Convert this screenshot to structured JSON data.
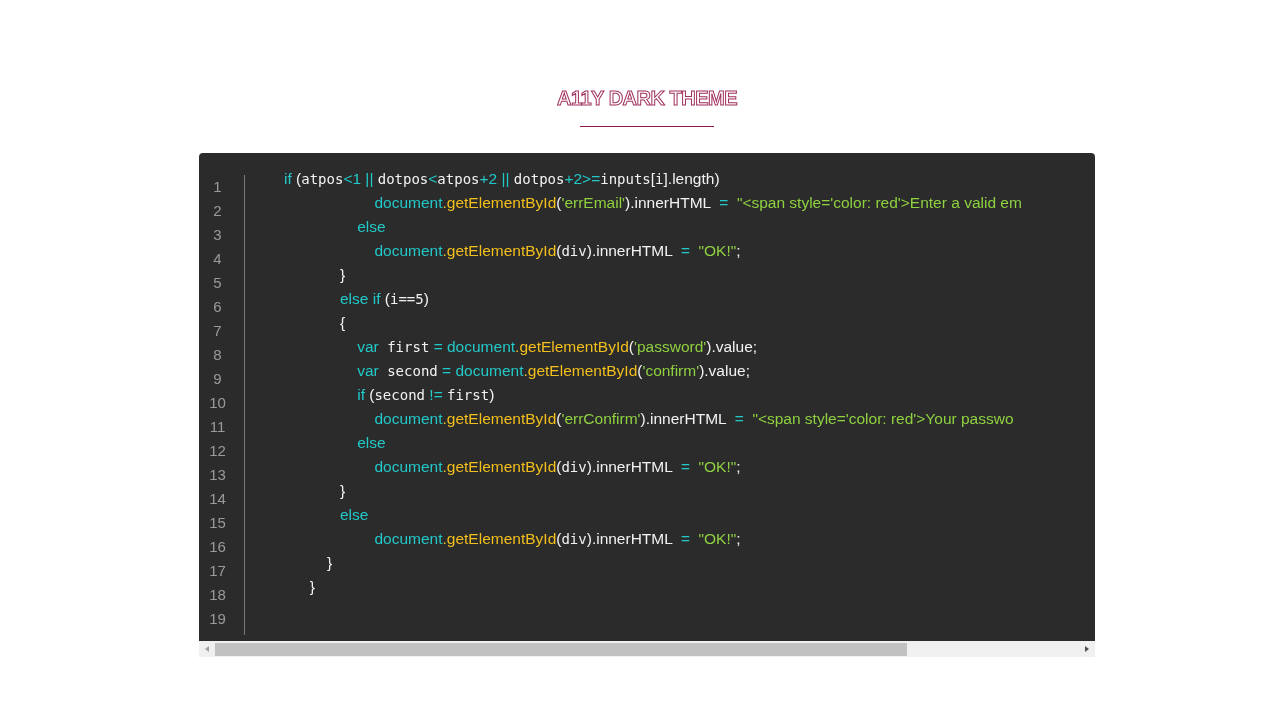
{
  "title": "A11Y DARK THEME",
  "code_block": {
    "lines": [
      {
        "number": "1",
        "tokens": [
          {
            "kind": "kw",
            "text": "if"
          },
          {
            "kind": "punct",
            "text": " ("
          },
          {
            "kind": "var",
            "text": "atpos"
          },
          {
            "kind": "op",
            "text": "<1 || "
          },
          {
            "kind": "var",
            "text": "dotpos"
          },
          {
            "kind": "op",
            "text": "<"
          },
          {
            "kind": "var",
            "text": "atpos"
          },
          {
            "kind": "op",
            "text": "+2 || "
          },
          {
            "kind": "var",
            "text": "dotpos"
          },
          {
            "kind": "op",
            "text": "+2>="
          },
          {
            "kind": "var",
            "text": "inputs"
          },
          {
            "kind": "punct",
            "text": "["
          },
          {
            "kind": "var",
            "text": "i"
          },
          {
            "kind": "punct",
            "text": "].length)"
          }
        ]
      },
      {
        "number": "2",
        "tokens": [
          {
            "kind": "obj",
            "text": "                     document"
          },
          {
            "kind": "method",
            "text": ".getElementById"
          },
          {
            "kind": "punct",
            "text": "("
          },
          {
            "kind": "str",
            "text": "'errEmail'"
          },
          {
            "kind": "punct",
            "text": ").innerHTML "
          },
          {
            "kind": "op",
            "text": " = "
          },
          {
            "kind": "str",
            "text": " \"<span style='color: red'>Enter a valid em"
          }
        ]
      },
      {
        "number": "3",
        "tokens": [
          {
            "kind": "kw",
            "text": "                 else"
          }
        ]
      },
      {
        "number": "4",
        "tokens": [
          {
            "kind": "obj",
            "text": "                     document"
          },
          {
            "kind": "method",
            "text": ".getElementById"
          },
          {
            "kind": "punct",
            "text": "("
          },
          {
            "kind": "var",
            "text": "div"
          },
          {
            "kind": "punct",
            "text": ").innerHTML "
          },
          {
            "kind": "op",
            "text": " = "
          },
          {
            "kind": "str",
            "text": " \"OK!\""
          },
          {
            "kind": "punct",
            "text": ";"
          }
        ]
      },
      {
        "number": "5",
        "tokens": [
          {
            "kind": "punct",
            "text": "             }"
          }
        ]
      },
      {
        "number": "6",
        "tokens": [
          {
            "kind": "kw",
            "text": "             else if"
          },
          {
            "kind": "punct",
            "text": " ("
          },
          {
            "kind": "var",
            "text": "i==5"
          },
          {
            "kind": "punct",
            "text": ")"
          }
        ]
      },
      {
        "number": "7",
        "tokens": [
          {
            "kind": "punct",
            "text": "             {"
          }
        ]
      },
      {
        "number": "8",
        "tokens": [
          {
            "kind": "kw",
            "text": "                 var"
          },
          {
            "kind": "var",
            "text": " first"
          },
          {
            "kind": "op",
            "text": " = "
          },
          {
            "kind": "obj",
            "text": "document"
          },
          {
            "kind": "method",
            "text": ".getElementById"
          },
          {
            "kind": "punct",
            "text": "("
          },
          {
            "kind": "str",
            "text": "'password'"
          },
          {
            "kind": "punct",
            "text": ").value;"
          }
        ]
      },
      {
        "number": "9",
        "tokens": [
          {
            "kind": "kw",
            "text": "                 var"
          },
          {
            "kind": "var",
            "text": " second"
          },
          {
            "kind": "op",
            "text": " = "
          },
          {
            "kind": "obj",
            "text": "document"
          },
          {
            "kind": "method",
            "text": ".getElementById"
          },
          {
            "kind": "punct",
            "text": "("
          },
          {
            "kind": "str",
            "text": "'confirm'"
          },
          {
            "kind": "punct",
            "text": ").value;"
          }
        ]
      },
      {
        "number": "10",
        "tokens": [
          {
            "kind": "kw",
            "text": "                 if"
          },
          {
            "kind": "punct",
            "text": " ("
          },
          {
            "kind": "var",
            "text": "second"
          },
          {
            "kind": "op",
            "text": " != "
          },
          {
            "kind": "var",
            "text": "first"
          },
          {
            "kind": "punct",
            "text": ")"
          }
        ]
      },
      {
        "number": "11",
        "tokens": [
          {
            "kind": "obj",
            "text": "                     document"
          },
          {
            "kind": "method",
            "text": ".getElementById"
          },
          {
            "kind": "punct",
            "text": "("
          },
          {
            "kind": "str",
            "text": "'errConfirm'"
          },
          {
            "kind": "punct",
            "text": ").innerHTML "
          },
          {
            "kind": "op",
            "text": " = "
          },
          {
            "kind": "str",
            "text": " \"<span style='color: red'>Your passwo"
          }
        ]
      },
      {
        "number": "12",
        "tokens": [
          {
            "kind": "kw",
            "text": "                 else"
          }
        ]
      },
      {
        "number": "13",
        "tokens": [
          {
            "kind": "obj",
            "text": "                     document"
          },
          {
            "kind": "method",
            "text": ".getElementById"
          },
          {
            "kind": "punct",
            "text": "("
          },
          {
            "kind": "var",
            "text": "div"
          },
          {
            "kind": "punct",
            "text": ").innerHTML "
          },
          {
            "kind": "op",
            "text": " = "
          },
          {
            "kind": "str",
            "text": " \"OK!\""
          },
          {
            "kind": "punct",
            "text": ";"
          }
        ]
      },
      {
        "number": "14",
        "tokens": [
          {
            "kind": "punct",
            "text": "             }"
          }
        ]
      },
      {
        "number": "15",
        "tokens": [
          {
            "kind": "kw",
            "text": "             else"
          }
        ]
      },
      {
        "number": "16",
        "tokens": [
          {
            "kind": "obj",
            "text": "                     document"
          },
          {
            "kind": "method",
            "text": ".getElementById"
          },
          {
            "kind": "punct",
            "text": "("
          },
          {
            "kind": "var",
            "text": "div"
          },
          {
            "kind": "punct",
            "text": ").innerHTML "
          },
          {
            "kind": "op",
            "text": " = "
          },
          {
            "kind": "str",
            "text": " \"OK!\""
          },
          {
            "kind": "punct",
            "text": ";"
          }
        ]
      },
      {
        "number": "17",
        "tokens": [
          {
            "kind": "punct",
            "text": "          }"
          }
        ]
      },
      {
        "number": "18",
        "tokens": [
          {
            "kind": "punct",
            "text": "      }"
          }
        ]
      },
      {
        "number": "19"
      }
    ]
  }
}
